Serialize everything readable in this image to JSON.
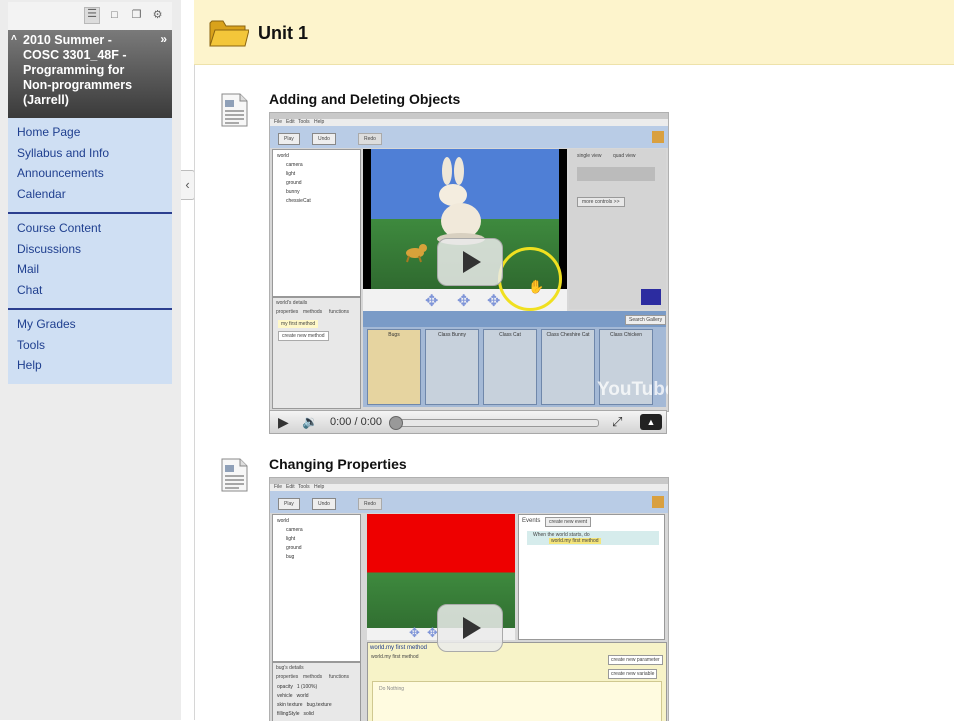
{
  "sidebar": {
    "toolbar_icons": [
      "list-view-icon",
      "folder-view-icon",
      "window-icon",
      "settings-icon"
    ],
    "course_title": "2010 Summer - COSC 3301_48F - Programming for Non-programmers (Jarrell)",
    "groups": [
      {
        "items": [
          {
            "label": "Home Page"
          },
          {
            "label": "Syllabus and Info"
          },
          {
            "label": "Announcements"
          },
          {
            "label": "Calendar"
          }
        ]
      },
      {
        "items": [
          {
            "label": "Course Content"
          },
          {
            "label": "Discussions"
          },
          {
            "label": "Mail"
          },
          {
            "label": "Chat"
          }
        ]
      },
      {
        "items": [
          {
            "label": "My Grades"
          },
          {
            "label": "Tools"
          },
          {
            "label": "Help"
          }
        ]
      }
    ]
  },
  "main": {
    "unit_title": "Unit 1",
    "items": [
      {
        "title": "Adding and Deleting Objects",
        "video": {
          "time": "0:00 / 0:00",
          "watermark": "YouTube",
          "app_menu": [
            "File",
            "Edit",
            "Tools",
            "Help"
          ],
          "app_buttons": [
            "Play",
            "Undo",
            "Redo"
          ],
          "tree_items": [
            "world",
            "camera",
            "light",
            "ground",
            "bunny",
            "chessieCat"
          ],
          "details_title": "world's details",
          "details_tabs": [
            "properties",
            "methods",
            "functions"
          ],
          "details_buttons": [
            "my first method",
            "create new method"
          ],
          "view_options": [
            "single view",
            "quad view"
          ],
          "more_controls": "more controls >>",
          "search_gallery": "Search Gallery",
          "gallery_items": [
            "Bugs",
            "Class Bunny",
            "Class Cat",
            "Class Cheshire Cat",
            "Class Chicken"
          ]
        }
      },
      {
        "title": "Changing Properties",
        "video": {
          "app_menu": [
            "File",
            "Edit",
            "Tools",
            "Help"
          ],
          "app_buttons": [
            "Play",
            "Undo",
            "Redo"
          ],
          "tree_items": [
            "world",
            "camera",
            "light",
            "ground",
            "bug"
          ],
          "events_label": "Events",
          "create_event": "create new event",
          "event_text": "When the world starts, do",
          "event_method": "world.my first method",
          "method_tab": "world.my first method",
          "method_header": "world.my first method",
          "method_params": "create new parameter",
          "method_vars": "create new variable",
          "do_nothing": "Do Nothing",
          "details_title": "bug's details",
          "details_tabs": [
            "properties",
            "methods",
            "functions"
          ],
          "props": [
            "opacity",
            "vehicle",
            "skin texture",
            "fillingStyle"
          ],
          "prop_values": [
            "1 (100%)",
            "world",
            "bug.texture",
            "solid"
          ]
        }
      }
    ]
  }
}
